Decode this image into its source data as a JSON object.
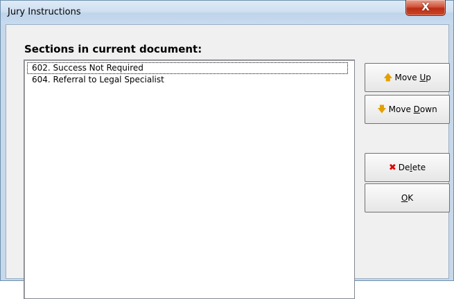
{
  "window": {
    "title": "Jury Instructions",
    "close_label": "X"
  },
  "main": {
    "section_label": "Sections in current document:",
    "sections": [
      {
        "label": "602. Success Not Required"
      },
      {
        "label": "604. Referral to Legal Specialist"
      }
    ]
  },
  "buttons": {
    "move_up": {
      "icon": "arrow-up-icon",
      "pre": "Move ",
      "accel": "U",
      "post": "p"
    },
    "move_down": {
      "icon": "arrow-down-icon",
      "pre": "Move ",
      "accel": "D",
      "post": "own"
    },
    "delete": {
      "icon": "red-x-icon",
      "pre": "De",
      "accel": "l",
      "post": "ete"
    },
    "ok": {
      "pre": "",
      "accel": "O",
      "post": "K"
    }
  },
  "colors": {
    "titlebar": "#cfe0f1",
    "close_button": "#c9472a",
    "dialog_bg": "#f0f0f0",
    "arrow_icon": "#e4a000",
    "delete_icon": "#e00000"
  }
}
